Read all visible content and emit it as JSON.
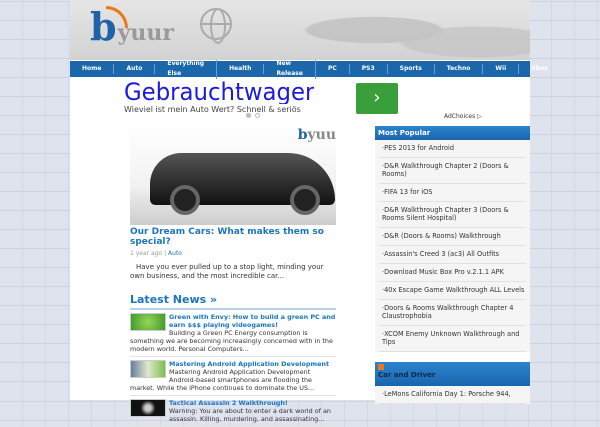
{
  "logo": {
    "text_b": "b",
    "text_rest": "yuur"
  },
  "nav": [
    "Home",
    "Auto",
    "Everything Else",
    "Health",
    "New Release",
    "PC",
    "PS3",
    "Sports",
    "Techno",
    "Wii",
    "Xbox"
  ],
  "ad": {
    "headline": "Gebrauchtwagen Wer",
    "sub": "Wieviel ist mein Auto Wert? Schnell & seriös bewerten lassen!",
    "button": "›",
    "adchoices": "AdChoices ▷"
  },
  "featured": {
    "brand_b": "b",
    "brand_rest": "yuu",
    "title": "Our Dream Cars: What makes them so special?",
    "age": "1 year ago",
    "sep": " | ",
    "category": "Auto",
    "excerpt": "Have you ever pulled up to a stop light, minding your own business, and the most incredible car..."
  },
  "latest": {
    "heading": "Latest News »",
    "items": [
      {
        "title": "Green with Envy: How to build a green PC and earn $$$ playing videogames!",
        "text": "Building a Green PC Energy consumption is something we are becoming increasingly concerned with in the modern world. Personal Computers..."
      },
      {
        "title": "Mastering Android Application Development",
        "text": "Mastering Android Application Development Android-based smartphones are flooding the market. While the iPhone continues to dominate the US..."
      },
      {
        "title": "Tactical Assassin 2 Walkthrough!",
        "text": "Warning: You are about to enter a dark world of an assassin. Killing, murdering, and assassinating..."
      }
    ]
  },
  "sidebar": {
    "popular_title": "Most Popular",
    "popular": [
      "PES 2013 for Android",
      "D&R Walkthrough Chapter 2 (Doors & Rooms)",
      "FIFA 13 for iOS",
      "D&R Walkthrough Chapter 3 (Doors & Rooms Silent Hospital)",
      "D&R (Doors & Rooms) Walkthrough",
      "Assassin's Creed 3 (ac3) All Outfits",
      "Download Music Box Pro v.2.1.1 APK",
      "40x Escape Game Walkthrough ALL Levels",
      "Doors & Rooms Walkthrough Chapter 4 Claustrophobia",
      "XCOM Enemy Unknown Walkthrough and Tips"
    ],
    "feed_title": "Car and Driver",
    "feed": [
      "LeMons California Day 1: Porsche 944,"
    ]
  }
}
